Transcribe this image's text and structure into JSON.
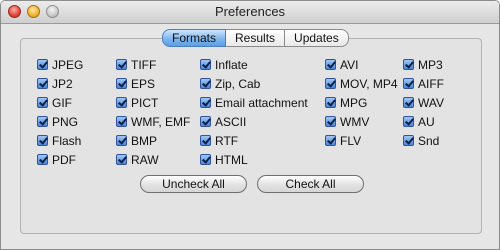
{
  "window": {
    "title": "Preferences"
  },
  "tabs": [
    {
      "label": "Formats",
      "active": true
    },
    {
      "label": "Results",
      "active": false
    },
    {
      "label": "Updates",
      "active": false
    }
  ],
  "columns": [
    [
      "JPEG",
      "JP2",
      "GIF",
      "PNG",
      "Flash",
      "PDF"
    ],
    [
      "TIFF",
      "EPS",
      "PICT",
      "WMF, EMF",
      "BMP",
      "RAW"
    ],
    [
      "Inflate",
      "Zip, Cab",
      "Email attachment",
      "ASCII",
      "RTF",
      "HTML"
    ],
    [
      "AVI",
      "MOV, MP4",
      "MPG",
      "WMV",
      "FLV"
    ],
    [
      "MP3",
      "AIFF",
      "WAV",
      "AU",
      "Snd"
    ]
  ],
  "checked": true,
  "buttons": {
    "uncheck_all": "Uncheck All",
    "check_all": "Check All"
  },
  "colors": {
    "tab_active": "#6aa8ea",
    "checkbox": "#4a86d6"
  }
}
